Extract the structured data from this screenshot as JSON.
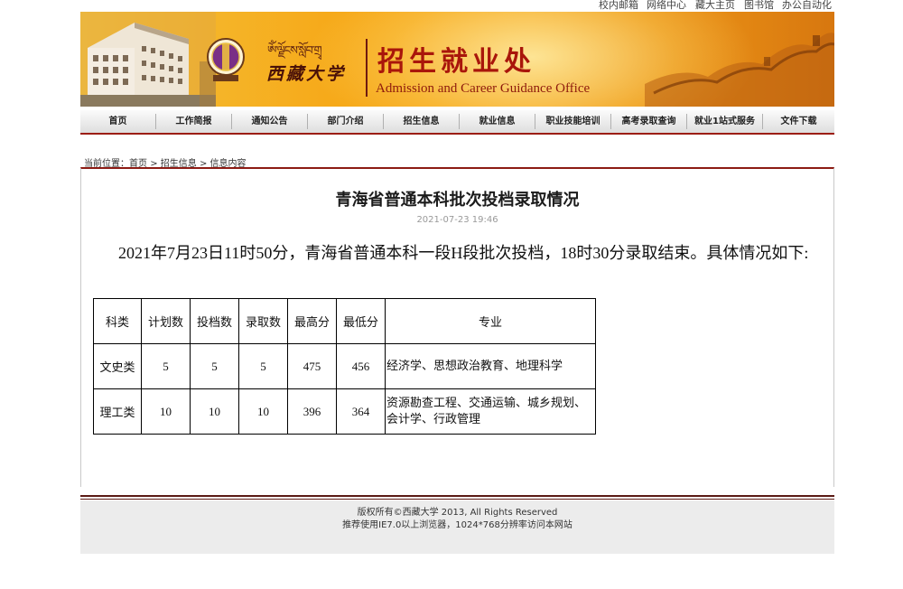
{
  "top_links": [
    "校内邮箱",
    "网络中心",
    "藏大主页",
    "图书馆",
    "办公自动化"
  ],
  "header": {
    "tibetan_text": "ༀ་ལྗོངས་སློབ་གྲྭ",
    "university_name": "西藏大学",
    "office_cn": "招生就业处",
    "office_en": "Admission and Career Guidance Office"
  },
  "nav": [
    "首页",
    "工作简报",
    "通知公告",
    "部门介绍",
    "招生信息",
    "就业信息",
    "职业技能培训",
    "高考录取查询",
    "就业1站式服务",
    "文件下载"
  ],
  "breadcrumb": {
    "prefix": "当前位置：",
    "home": "首页",
    "sep": ">",
    "category": "招生信息",
    "current": "信息内容"
  },
  "article": {
    "title": "青海省普通本科批次投档录取情况",
    "date": "2021-07-23 19:46",
    "body": "2021年7月23日11时50分，青海省普通本科一段H段批次投档，18时30分录取结束。具体情况如下:"
  },
  "table": {
    "headers": [
      "科类",
      "计划数",
      "投档数",
      "录取数",
      "最高分",
      "最低分",
      "专业"
    ],
    "rows": [
      [
        "文史类",
        "5",
        "5",
        "5",
        "475",
        "456",
        "经济学、思想政治教育、地理科学"
      ],
      [
        "理工类",
        "10",
        "10",
        "10",
        "396",
        "364",
        "资源勘查工程、交通运输、城乡规划、会计学、行政管理"
      ]
    ]
  },
  "footer": {
    "copyright": "版权所有©西藏大学 2013, All Rights Reserved",
    "browser_note": "推荐使用IE7.0以上浏览器，1024*768分辨率访问本网站"
  },
  "colors": {
    "accent": "#9c1d12",
    "banner": "#f3a01a",
    "office_text": "#a9160b"
  }
}
